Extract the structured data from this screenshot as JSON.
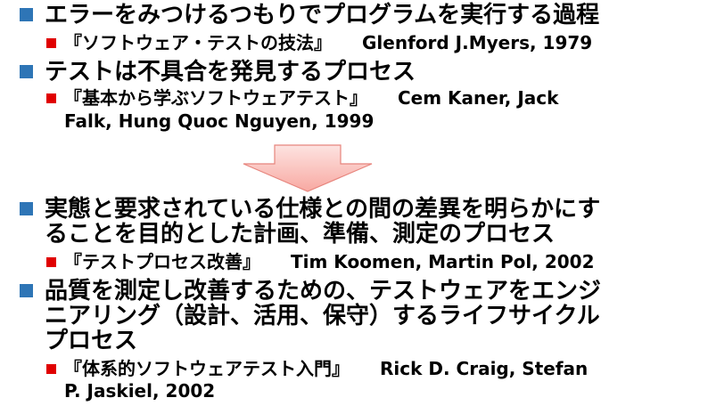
{
  "sections": [
    {
      "heading": "エラーをみつけるつもりでプログラムを実行する過程",
      "source_title": "『ソフトウェア・テストの技法』",
      "source_authors": "Glenford J.Myers, 1979"
    },
    {
      "heading": "テストは不具合を発見するプロセス",
      "source_title": "『基本から学ぶソフトウェアテスト』",
      "source_authors_line1": "Cem Kaner, Jack",
      "source_authors_line2": "Falk, Hung Quoc Nguyen, 1999"
    },
    {
      "heading_line1": "実態と要求されている仕様との間の差異を明らかにす",
      "heading_line2": "ることを目的とした計画、準備、測定のプロセス",
      "source_title": "『テストプロセス改善』",
      "source_authors": "Tim Koomen, Martin Pol, 2002"
    },
    {
      "heading_line1": "品質を測定し改善するための、テストウェアをエンジ",
      "heading_line2": "ニアリング（設計、活用、保守）するライフサイクル",
      "heading_line3": "プロセス",
      "source_title": "『体系的ソフトウェアテスト入門』",
      "source_authors_line1": "Rick D. Craig, Stefan",
      "source_authors_line2": "P. Jaskiel, 2002"
    }
  ],
  "colors": {
    "level1_bullet": "#2e75b6",
    "level2_bullet": "#e00000",
    "arrow_fill_top": "#fde3e1",
    "arrow_fill_bottom": "#f8a9a2",
    "arrow_stroke": "#e7857d"
  },
  "icons": {
    "arrow": "down-arrow-icon"
  }
}
